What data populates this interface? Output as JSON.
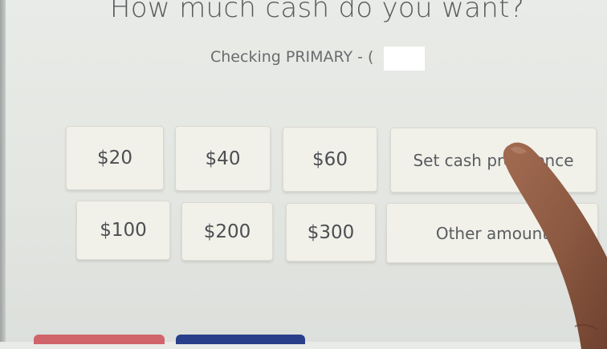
{
  "screen": {
    "title": "How much cash do you want?",
    "account": "Checking PRIMARY - ("
  },
  "amounts": {
    "row1": [
      "$20",
      "$40",
      "$60"
    ],
    "row2": [
      "$100",
      "$200",
      "$300"
    ]
  },
  "actions": {
    "set_preference": "Set cash preference",
    "other_amount": "Other amount"
  },
  "colors": {
    "background": "#e6e8e4",
    "button": "#f1f1ea",
    "text": "#4c4e52",
    "cancel_button": "#d1646a",
    "back_button": "#2a3f8a"
  }
}
